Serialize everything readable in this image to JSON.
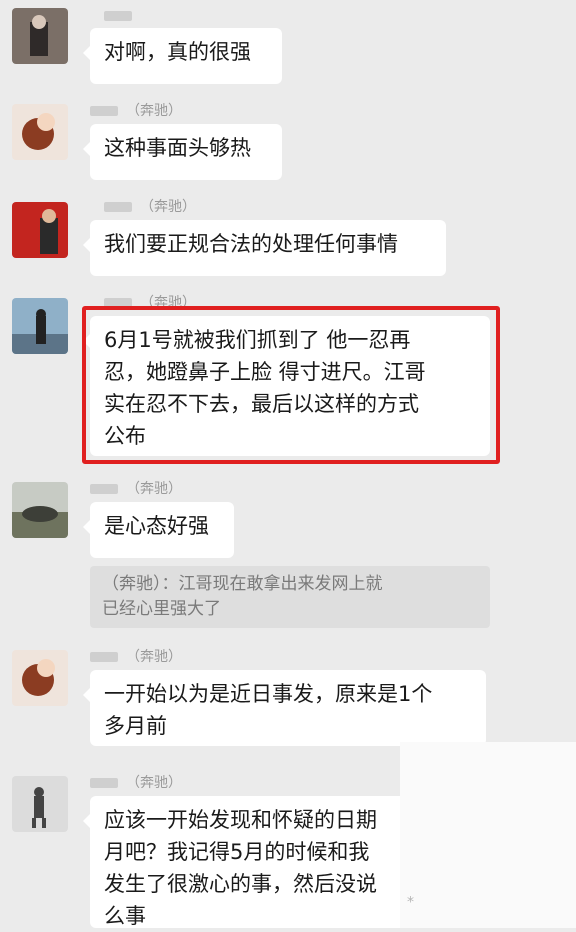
{
  "messages": [
    {
      "sender_tag": "",
      "text": "对啊，真的很强"
    },
    {
      "sender_tag": "（奔驰）",
      "text": "这种事面头够热"
    },
    {
      "sender_tag": "（奔驰）",
      "text": "我们要正规合法的处理任何事情"
    },
    {
      "sender_tag": "（奔驰）",
      "text": "6月1号就被我们抓到了  他一忍再\n忍，她蹬鼻子上脸  得寸进尺。江哥\n实在忍不下去，最后以这样的方式\n公布"
    },
    {
      "sender_tag": "（奔驰）",
      "text": "是心态好强"
    },
    {
      "sender_tag": "（奔驰）",
      "text": "一开始以为是近日事发，原来是1个\n多月前"
    },
    {
      "sender_tag": "（奔驰）",
      "text": "应该一开始发现和怀疑的日期\n月吧？我记得5月的时候和我\n发生了很激心的事，然后没说\n么事"
    }
  ],
  "quote": {
    "text": "（奔驰）：江哥现在敢拿出来发网上就\n已经心里强大了"
  },
  "colors": {
    "background": "#ebebeb",
    "bubble": "#ffffff",
    "highlight_border": "#e02020",
    "quote_bg": "#dedede"
  }
}
